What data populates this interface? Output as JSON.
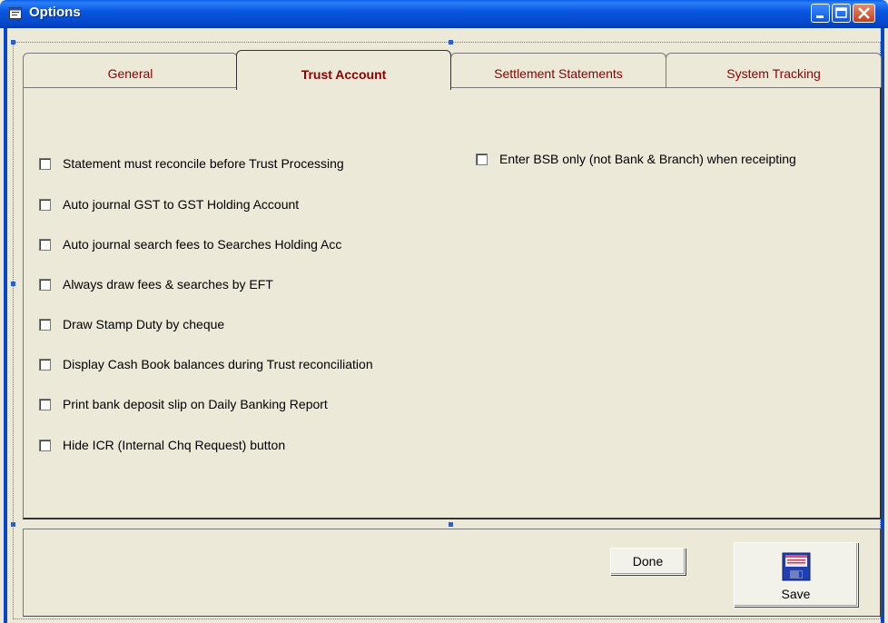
{
  "window": {
    "title": "Options"
  },
  "tabs": [
    {
      "label": "General",
      "active": false
    },
    {
      "label": "Trust Account",
      "active": true
    },
    {
      "label": "Settlement Statements",
      "active": false
    },
    {
      "label": "System Tracking",
      "active": false
    }
  ],
  "options_left": [
    {
      "label": "Statement must reconcile before Trust Processing",
      "checked": false
    },
    {
      "label": "Auto journal GST to GST Holding Account",
      "checked": false
    },
    {
      "label": "Auto journal search fees to Searches Holding Acc",
      "checked": false
    },
    {
      "label": "Always draw fees & searches by EFT",
      "checked": false
    },
    {
      "label": "Draw Stamp Duty by cheque",
      "checked": false
    },
    {
      "label": "Display Cash Book balances during Trust reconciliation",
      "checked": false
    },
    {
      "label": "Print bank deposit slip on Daily Banking Report",
      "checked": false
    },
    {
      "label": "Hide ICR (Internal Chq Request) button",
      "checked": false
    }
  ],
  "options_right": [
    {
      "label": "Enter BSB only (not Bank & Branch)  when receipting",
      "checked": false
    }
  ],
  "buttons": {
    "done_label": "Done",
    "save_label": "Save"
  },
  "icons": {
    "window": "window-icon",
    "save": "floppy-disk-icon"
  },
  "colors": {
    "tab_text": "#8b0000",
    "titlebar": "#0a56e0"
  }
}
